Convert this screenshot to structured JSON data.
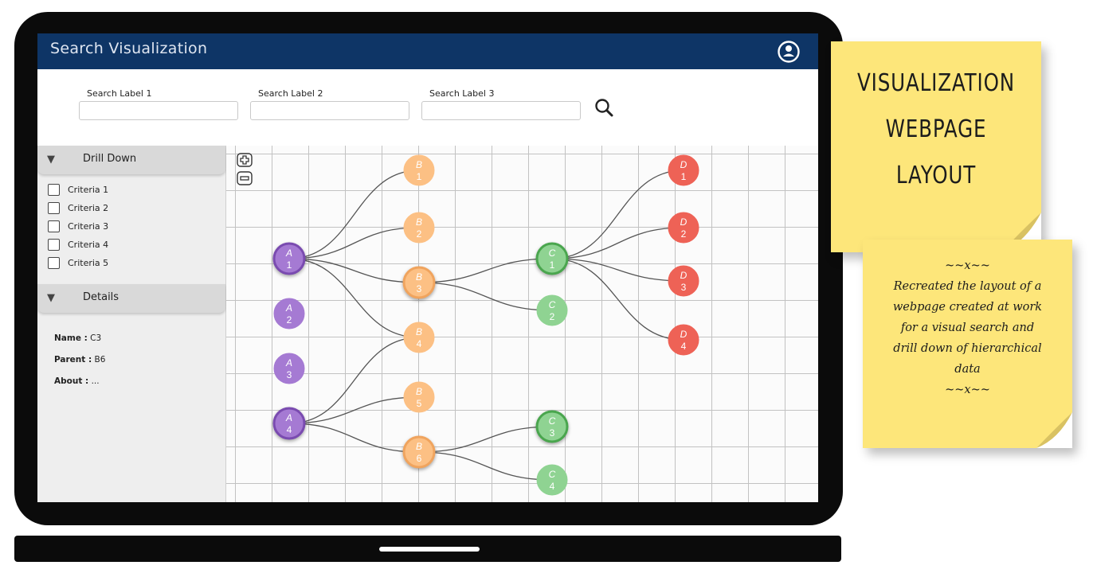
{
  "app": {
    "title": "Search Visualization"
  },
  "search": {
    "fields": [
      {
        "label": "Search Label 1",
        "value": ""
      },
      {
        "label": "Search Label 2",
        "value": ""
      },
      {
        "label": "Search Label 3",
        "value": ""
      }
    ]
  },
  "sidebar": {
    "drill_down": {
      "title": "Drill Down",
      "criteria": [
        "Criteria 1",
        "Criteria 2",
        "Criteria 3",
        "Criteria 4",
        "Criteria 5"
      ]
    },
    "details": {
      "title": "Details",
      "name_label": "Name :",
      "name_value": "C3",
      "parent_label": "Parent :",
      "parent_value": "B6",
      "about_label": "About :",
      "about_value": "..."
    }
  },
  "graph": {
    "groups": [
      {
        "id": "A",
        "color": "#a57ad3",
        "stroke": "#7a4bb0",
        "text": "#ffffff",
        "nodes": [
          {
            "letter": "A",
            "num": "1"
          },
          {
            "letter": "A",
            "num": "2"
          },
          {
            "letter": "A",
            "num": "3"
          },
          {
            "letter": "A",
            "num": "4"
          }
        ]
      },
      {
        "id": "B",
        "color": "#fcc084",
        "stroke": "#f0a45e",
        "text": "#ffffff",
        "nodes": [
          {
            "letter": "B",
            "num": "1"
          },
          {
            "letter": "B",
            "num": "2"
          },
          {
            "letter": "B",
            "num": "3"
          },
          {
            "letter": "B",
            "num": "4"
          },
          {
            "letter": "B",
            "num": "5"
          },
          {
            "letter": "B",
            "num": "6"
          }
        ]
      },
      {
        "id": "C",
        "color": "#8fd392",
        "stroke": "#4aa64e",
        "text": "#ffffff",
        "nodes": [
          {
            "letter": "C",
            "num": "1"
          },
          {
            "letter": "C",
            "num": "2"
          },
          {
            "letter": "C",
            "num": "3"
          },
          {
            "letter": "C",
            "num": "4"
          }
        ]
      },
      {
        "id": "D",
        "color": "#ee6256",
        "stroke": "#c84438",
        "text": "#ffffff",
        "nodes": [
          {
            "letter": "D",
            "num": "1"
          },
          {
            "letter": "D",
            "num": "2"
          },
          {
            "letter": "D",
            "num": "3"
          },
          {
            "letter": "D",
            "num": "4"
          }
        ]
      }
    ],
    "edges": [
      [
        "A1",
        "B1"
      ],
      [
        "A1",
        "B2"
      ],
      [
        "A1",
        "B3"
      ],
      [
        "A1",
        "B4"
      ],
      [
        "A4",
        "B4"
      ],
      [
        "A4",
        "B5"
      ],
      [
        "A4",
        "B6"
      ],
      [
        "B3",
        "C1"
      ],
      [
        "B3",
        "C2"
      ],
      [
        "B6",
        "C3"
      ],
      [
        "B6",
        "C4"
      ],
      [
        "C1",
        "D1"
      ],
      [
        "C1",
        "D2"
      ],
      [
        "C1",
        "D3"
      ],
      [
        "C1",
        "D4"
      ]
    ],
    "selected": [
      "A1",
      "B3",
      "C1",
      "A4",
      "B6",
      "C3"
    ]
  },
  "notes": {
    "title": "Visualization\nwebpage\nlayout",
    "body": [
      "~~x~~",
      "Recreated the layout of a",
      "webpage created at work",
      "for a visual search and",
      "drill down of hierarchical",
      "data",
      "~~x~~"
    ]
  },
  "icons": {
    "user": "user-circle-icon",
    "search": "magnifier-icon",
    "zoom_in": "zoom-in-icon",
    "zoom_out": "zoom-out-icon",
    "collapse": "triangle-down-icon"
  }
}
